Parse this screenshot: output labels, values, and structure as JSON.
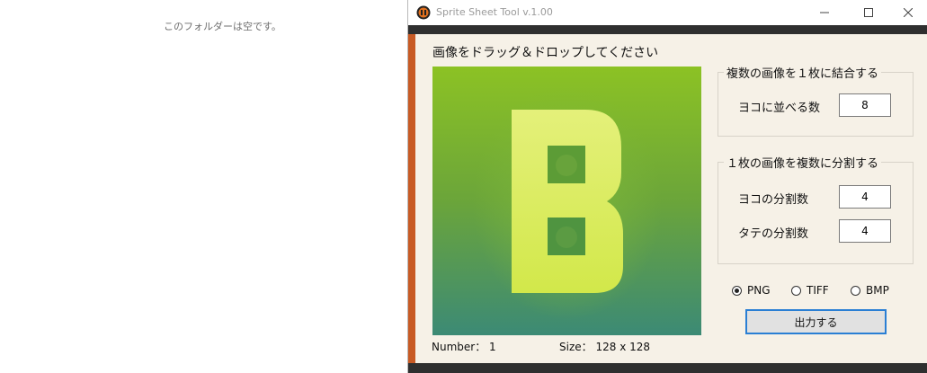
{
  "explorer": {
    "empty_message": "このフォルダーは空です。"
  },
  "window": {
    "title": "Sprite Sheet Tool v.1.00",
    "icon": "app-logo-icon",
    "controls": {
      "minimize": "─",
      "maximize": "☐",
      "close": "✕"
    }
  },
  "drop_area": {
    "label": "画像をドラッグ＆ドロップしてください",
    "preview_letter": "B"
  },
  "info": {
    "number_label": "Number：",
    "number_value": "1",
    "size_label": "Size：",
    "size_value": "128 x 128"
  },
  "combine": {
    "legend": "複数の画像を１枚に結合する",
    "cols_label": "ヨコに並べる数",
    "cols_value": "8"
  },
  "split": {
    "legend": "１枚の画像を複数に分割する",
    "cols_label": "ヨコの分割数",
    "cols_value": "4",
    "rows_label": "タテの分割数",
    "rows_value": "4"
  },
  "formats": {
    "selected": "PNG",
    "options": [
      "PNG",
      "TIFF",
      "BMP"
    ]
  },
  "output_button_label": "出力する",
  "colors": {
    "accent": "#c85a24",
    "window_bg": "#f6f1e7",
    "button_border": "#2a7fd4",
    "preview_top": "#8cc224",
    "preview_bottom": "#3c8a75",
    "letter": "#d6ea4a"
  }
}
